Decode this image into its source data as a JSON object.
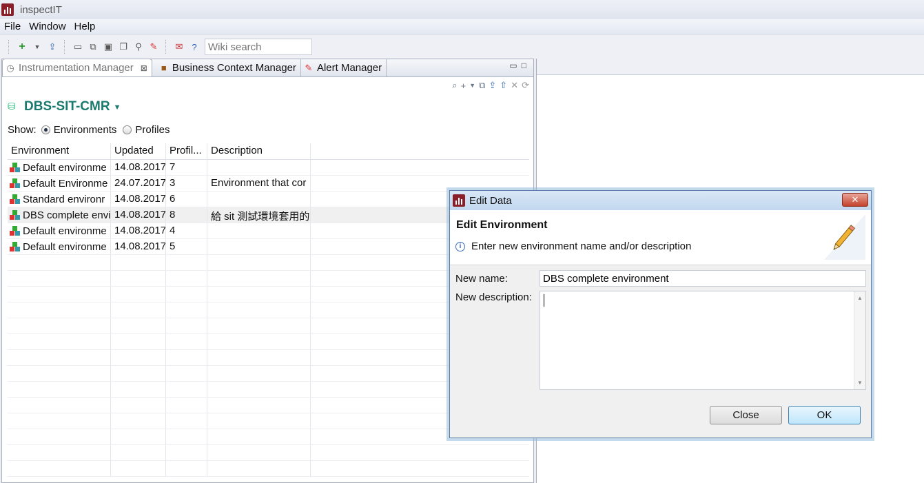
{
  "app": {
    "title": "inspectIT"
  },
  "menu": [
    "File",
    "Window",
    "Help"
  ],
  "toolbar": {
    "wiki_placeholder": "Wiki search"
  },
  "tabs": [
    {
      "label": "Instrumentation Manager",
      "icon": "compass-icon"
    },
    {
      "label": "Business Context Manager",
      "icon": "briefcase-icon"
    },
    {
      "label": "Alert Manager",
      "icon": "alarm-icon"
    }
  ],
  "env": {
    "name": "DBS-SIT-CMR"
  },
  "show": {
    "label": "Show:",
    "environments": "Environments",
    "profiles": "Profiles"
  },
  "table": {
    "headers": [
      "Environment",
      "Updated",
      "Profil...",
      "Description"
    ],
    "rows": [
      [
        "Default environme",
        "14.08.2017",
        "7",
        ""
      ],
      [
        "Default Environme",
        "24.07.2017",
        "3",
        "Environment that cor"
      ],
      [
        "Standard environr",
        "14.08.2017",
        "6",
        ""
      ],
      [
        "DBS complete envi",
        "14.08.2017",
        "8",
        "給 sit 測試環境套用的"
      ],
      [
        "Default environme",
        "14.08.2017",
        "4",
        ""
      ],
      [
        "Default environme",
        "14.08.2017",
        "5",
        ""
      ]
    ]
  },
  "dialog": {
    "title": "Edit Data",
    "heading": "Edit Environment",
    "message": "Enter new environment name and/or description",
    "name_label": "New name:",
    "name_value": "DBS complete environment",
    "desc_label": "New description:",
    "desc_value": "",
    "close_label": "Close",
    "ok_label": "OK"
  }
}
